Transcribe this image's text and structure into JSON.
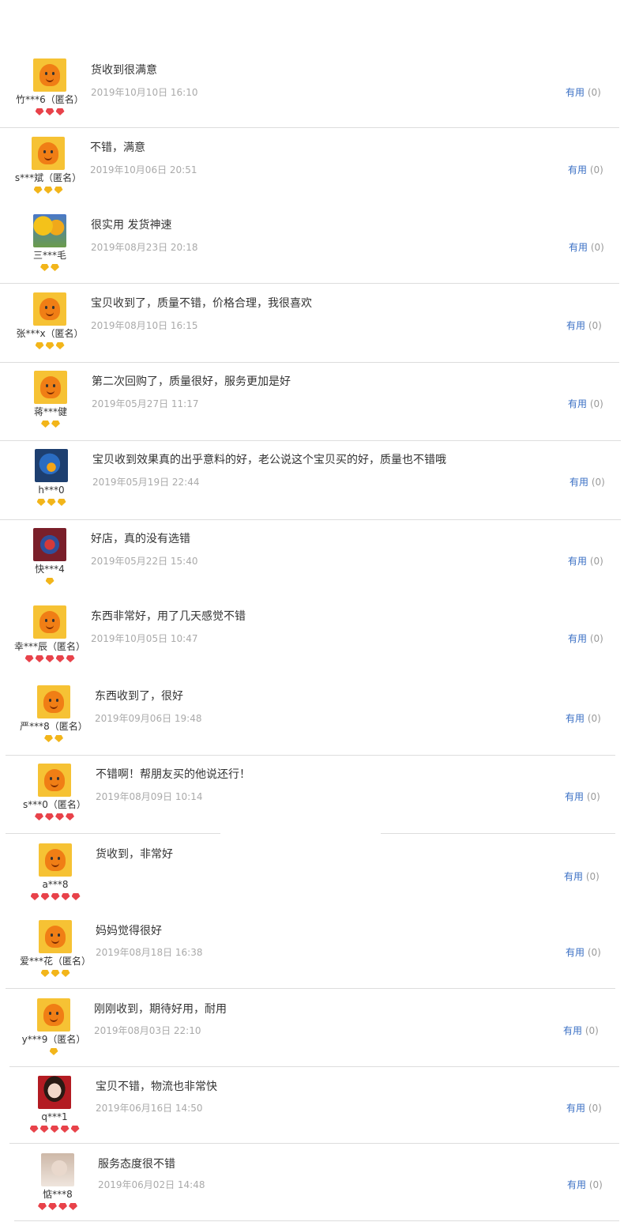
{
  "useful_label": "有用",
  "reviews": [
    {
      "user": "竹***6（匿名）",
      "avatar": "default",
      "gem": "red",
      "gems": 3,
      "content": "货收到很满意",
      "date": "2019年10月10日 16:10",
      "useful": "(0)"
    },
    {
      "user": "s***斌（匿名）",
      "avatar": "default",
      "gem": "yellow",
      "gems": 3,
      "content": "不错，满意",
      "date": "2019年10月06日 20:51",
      "useful": "(0)"
    },
    {
      "user": "三***毛",
      "avatar": "flower",
      "gem": "yellow",
      "gems": 2,
      "content": "很实用 发货神速",
      "date": "2019年08月23日 20:18",
      "useful": "(0)"
    },
    {
      "user": "张***x（匿名）",
      "avatar": "default",
      "gem": "yellow",
      "gems": 3,
      "content": "宝贝收到了，质量不错，价格合理，我很喜欢",
      "date": "2019年08月10日 16:15",
      "useful": "(0)"
    },
    {
      "user": "蒋***健",
      "avatar": "default",
      "gem": "yellow",
      "gems": 2,
      "content": "第二次回购了，质量很好，服务更加是好",
      "date": "2019年05月27日 11:17",
      "useful": "(0)"
    },
    {
      "user": "h***0",
      "avatar": "bird",
      "gem": "yellow",
      "gems": 3,
      "content": "宝贝收到效果真的出乎意料的好，老公说这个宝贝买的好，质量也不错哦",
      "date": "2019年05月19日 22:44",
      "useful": "(0)"
    },
    {
      "user": "快***4",
      "avatar": "lion",
      "gem": "yellow",
      "gems": 1,
      "content": "好店，真的没有选错",
      "date": "2019年05月22日 15:40",
      "useful": "(0)"
    },
    {
      "user": "幸***辰（匿名）",
      "avatar": "default",
      "gem": "red",
      "gems": 5,
      "content": "东西非常好，用了几天感觉不错",
      "date": "2019年10月05日 10:47",
      "useful": "(0)"
    },
    {
      "user": "严***8（匿名）",
      "avatar": "default",
      "gem": "yellow",
      "gems": 2,
      "content": "东西收到了，很好",
      "date": "2019年09月06日 19:48",
      "useful": "(0)"
    },
    {
      "user": "s***0（匿名）",
      "avatar": "default",
      "gem": "red",
      "gems": 4,
      "content": "不错啊！帮朋友买的他说还行！",
      "date": "2019年08月09日 10:14",
      "useful": "(0)"
    },
    {
      "user": "a***8",
      "avatar": "default",
      "gem": "red",
      "gems": 5,
      "content": "货收到，非常好",
      "date": "",
      "useful": "(0)"
    },
    {
      "user": "爱***花（匿名）",
      "avatar": "default",
      "gem": "yellow",
      "gems": 3,
      "content": "妈妈觉得很好",
      "date": "2019年08月18日 16:38",
      "useful": "(0)"
    },
    {
      "user": "y***9（匿名）",
      "avatar": "default",
      "gem": "yellow",
      "gems": 1,
      "content": "刚刚收到，期待好用，耐用",
      "date": "2019年08月03日 22:10",
      "useful": "(0)"
    },
    {
      "user": "q***1",
      "avatar": "girl",
      "gem": "red",
      "gems": 5,
      "content": "宝贝不错，物流也非常快",
      "date": "2019年06月16日 14:50",
      "useful": "(0)"
    },
    {
      "user": "惦***8",
      "avatar": "soft",
      "gem": "red",
      "gems": 4,
      "content": "服务态度很不错",
      "date": "2019年06月02日 14:48",
      "useful": "(0)"
    }
  ]
}
